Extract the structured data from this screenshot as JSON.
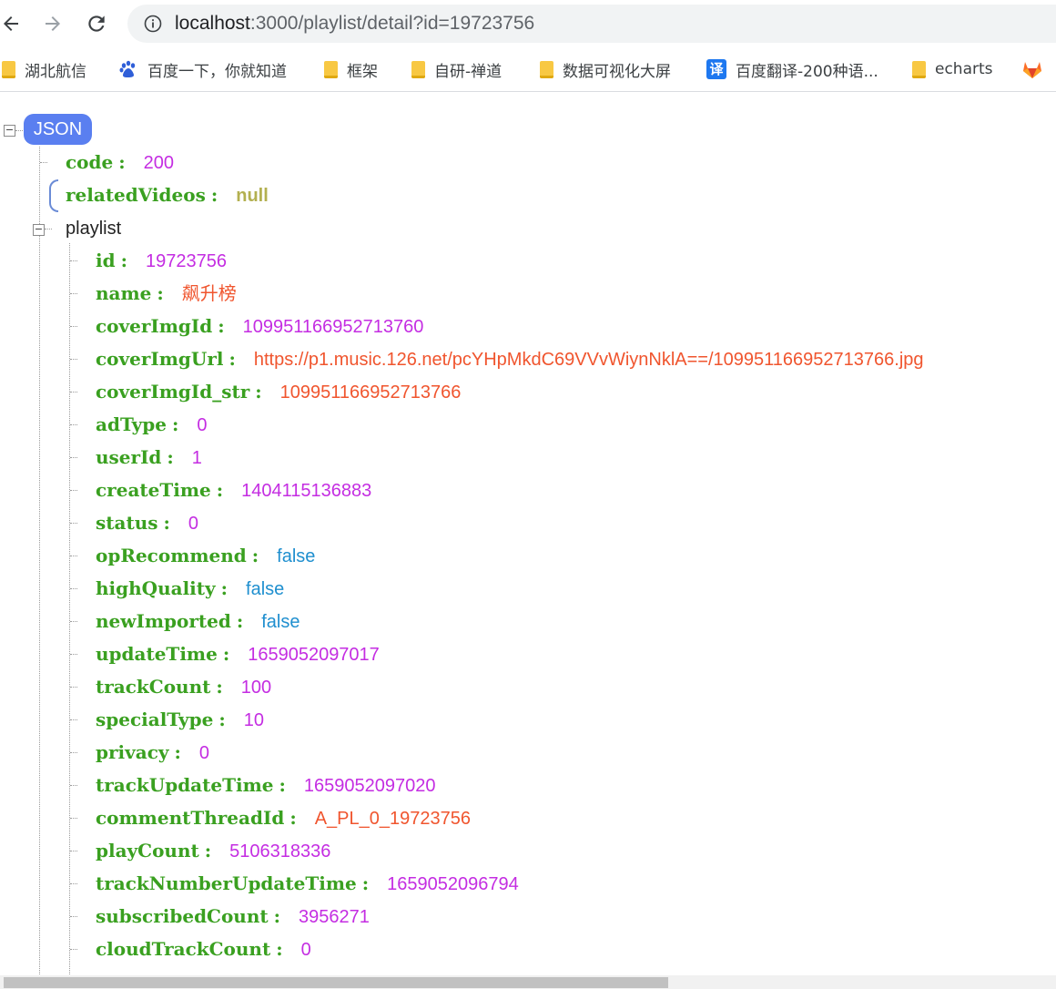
{
  "browser": {
    "url_host": "localhost",
    "url_rest": ":3000/playlist/detail?id=19723756",
    "bookmarks": [
      {
        "icon": "folder-icon",
        "label": "湖北航信"
      },
      {
        "icon": "baidu-paw-icon",
        "label": "百度一下，你就知道"
      },
      {
        "icon": "folder-icon",
        "label": "框架"
      },
      {
        "icon": "folder-icon",
        "label": "自研-禅道"
      },
      {
        "icon": "folder-icon",
        "label": "数据可视化大屏"
      },
      {
        "icon": "translate-icon",
        "icon_text": "译",
        "label": "百度翻译-200种语..."
      },
      {
        "icon": "folder-icon",
        "label": "echarts"
      },
      {
        "icon": "gitlab-fox-icon",
        "label": ""
      }
    ]
  },
  "viewer": {
    "root_label": "JSON",
    "root_toggle": "⊟",
    "code": {
      "key": "code",
      "value": "200"
    },
    "relatedVideos": {
      "key": "relatedVideos",
      "value": "null"
    },
    "playlist_label": "playlist",
    "playlist_fields": [
      {
        "key": "id",
        "value": "19723756",
        "type": "number"
      },
      {
        "key": "name",
        "value": "飙升榜",
        "type": "string"
      },
      {
        "key": "coverImgId",
        "value": "109951166952713760",
        "type": "number"
      },
      {
        "key": "coverImgUrl",
        "value": "https://p1.music.126.net/pcYHpMkdC69VVvWiynNklA==/109951166952713766.jpg",
        "type": "string"
      },
      {
        "key": "coverImgId_str",
        "value": "109951166952713766",
        "type": "string"
      },
      {
        "key": "adType",
        "value": "0",
        "type": "number"
      },
      {
        "key": "userId",
        "value": "1",
        "type": "number"
      },
      {
        "key": "createTime",
        "value": "1404115136883",
        "type": "number"
      },
      {
        "key": "status",
        "value": "0",
        "type": "number"
      },
      {
        "key": "opRecommend",
        "value": "false",
        "type": "bool"
      },
      {
        "key": "highQuality",
        "value": "false",
        "type": "bool"
      },
      {
        "key": "newImported",
        "value": "false",
        "type": "bool"
      },
      {
        "key": "updateTime",
        "value": "1659052097017",
        "type": "number"
      },
      {
        "key": "trackCount",
        "value": "100",
        "type": "number"
      },
      {
        "key": "specialType",
        "value": "10",
        "type": "number"
      },
      {
        "key": "privacy",
        "value": "0",
        "type": "number"
      },
      {
        "key": "trackUpdateTime",
        "value": "1659052097020",
        "type": "number"
      },
      {
        "key": "commentThreadId",
        "value": "A_PL_0_19723756",
        "type": "string"
      },
      {
        "key": "playCount",
        "value": "5106318336",
        "type": "number"
      },
      {
        "key": "trackNumberUpdateTime",
        "value": "1659052096794",
        "type": "number"
      },
      {
        "key": "subscribedCount",
        "value": "3956271",
        "type": "number"
      },
      {
        "key": "cloudTrackCount",
        "value": "0",
        "type": "number"
      }
    ],
    "colon": ":"
  },
  "colors": {
    "key": "#3aa020",
    "number": "#c42de2",
    "string": "#f0552e",
    "bool": "#1f8fcf",
    "null": "#b3b050",
    "badge": "#5a7ff0"
  }
}
